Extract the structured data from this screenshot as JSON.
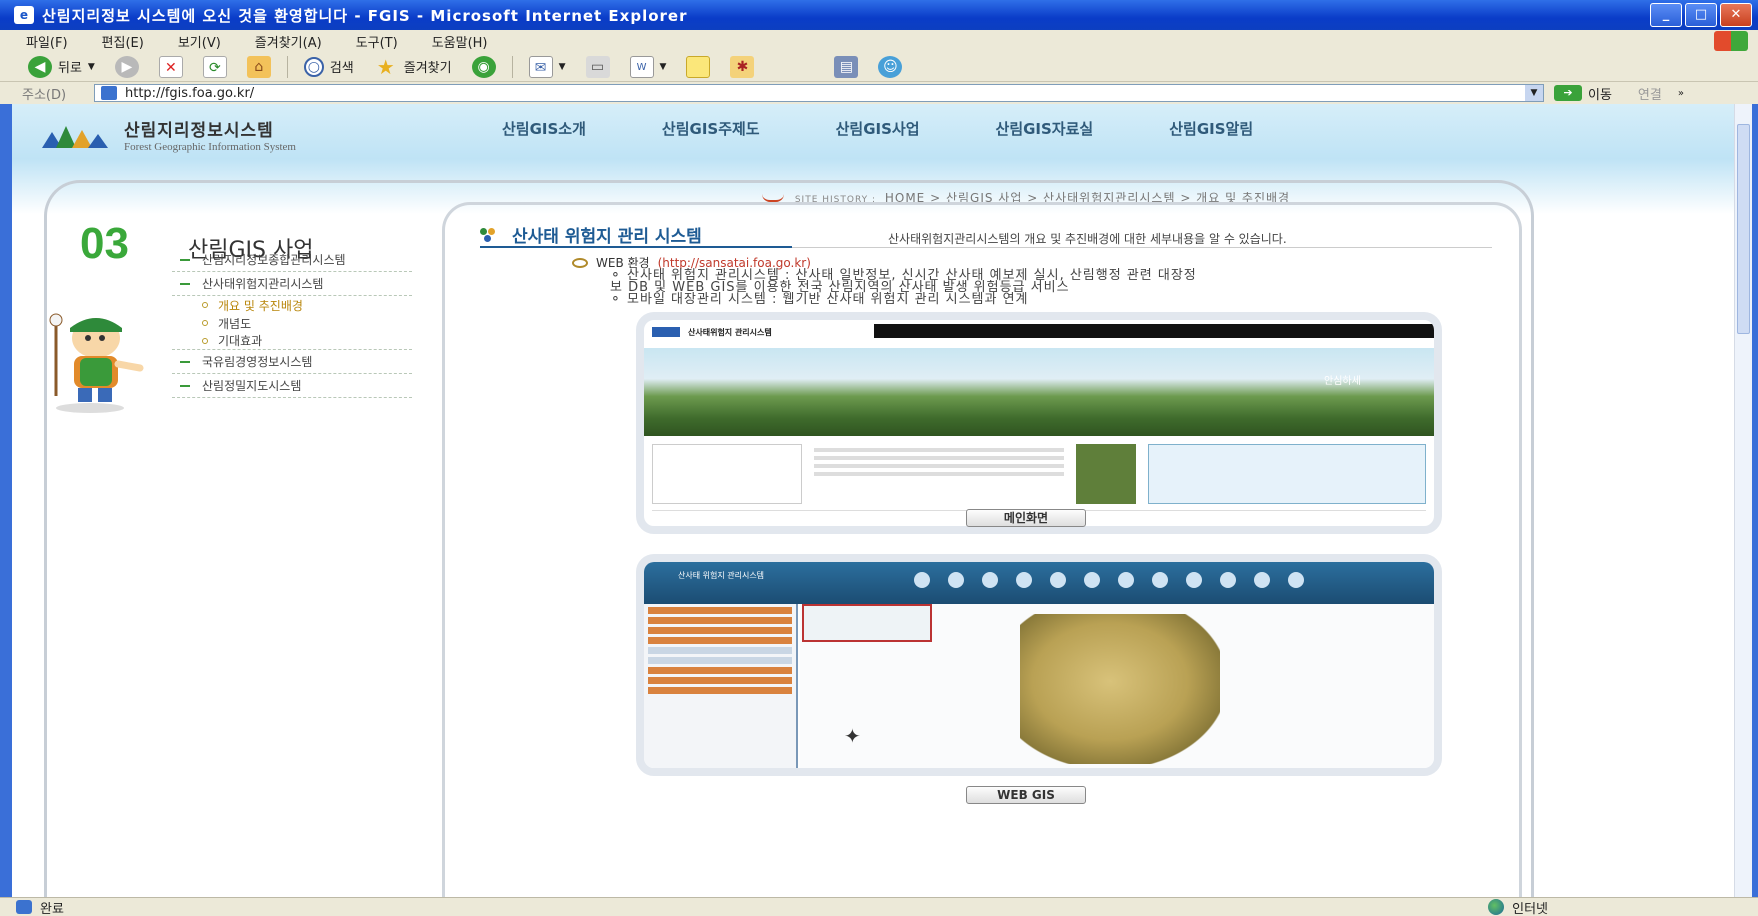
{
  "window": {
    "title": "산림지리정보 시스템에 오신 것을 환영합니다 - FGIS - Microsoft Internet Explorer",
    "minimize": "_",
    "maximize": "□",
    "close": "✕"
  },
  "menubar": [
    "파일(F)",
    "편집(E)",
    "보기(V)",
    "즐겨찾기(A)",
    "도구(T)",
    "도움말(H)"
  ],
  "toolbar": {
    "back_label": "뒤로",
    "search_label": "검색",
    "favorites_label": "즐겨찾기"
  },
  "address": {
    "label": "주소(D)",
    "url": "http://fgis.foa.go.kr/",
    "go_label": "이동",
    "links_label": "연결"
  },
  "site": {
    "logo_title": "산림지리정보시스템",
    "logo_subtitle": "Forest Geographic Information System",
    "gnb": [
      "산림GIS소개",
      "산림GIS주제도",
      "산림GIS사업",
      "산림GIS자료실",
      "산림GIS알림"
    ]
  },
  "breadcrumb": {
    "prefix": "SITE HISTORY :",
    "path": "HOME > 산림GIS 사업 > 산사태위험지관리시스템 > 개요 및 추진배경"
  },
  "section": {
    "number": "03",
    "title": "산림GIS 사업"
  },
  "lnb": {
    "item1": "산림지리정보종합관리시스템",
    "item2": "산사태위험지관리시스템",
    "sub1": "개요 및 추진배경",
    "sub2": "개념도",
    "sub3": "기대효과",
    "item3": "국유림경영정보시스템",
    "item4": "산림정밀지도시스템"
  },
  "content": {
    "title": "산사태 위험지 관리 시스템",
    "description": "산사태위험지관리시스템의 개요 및 추진배경에 대한 세부내용을 알 수 있습니다.",
    "web_env_label": "WEB 환경",
    "web_env_url": "(http://sansatai.foa.go.kr)",
    "line1": "⚬ 산사태 위험지 관리시스템 : 산사태 일반정보, 신시간 산사태 예보제 실시, 산림행정 관련 대장정",
    "line2": "보    DB 및 WEB GIS를 이용한 전국 산림지역의 산사태 발생 위험등급 서비스",
    "line3": "⚬ 모바일 대장관리 시스템 : 웹기반 산사태 위험지 관리 시스템과 연계",
    "shot1_site_title": "산사태위험지 관리시스템",
    "shot1_banner_text": "안심하세",
    "main_button": "메인화면",
    "webgis_button": "WEB GIS",
    "shot2_title": "산사태 위험지 관리시스템"
  },
  "status": {
    "left": "완료",
    "right": "인터넷"
  },
  "colors": {
    "accent_green": "#3aa83a",
    "title_blue": "#1e5b94",
    "url_red": "#c0392b"
  }
}
